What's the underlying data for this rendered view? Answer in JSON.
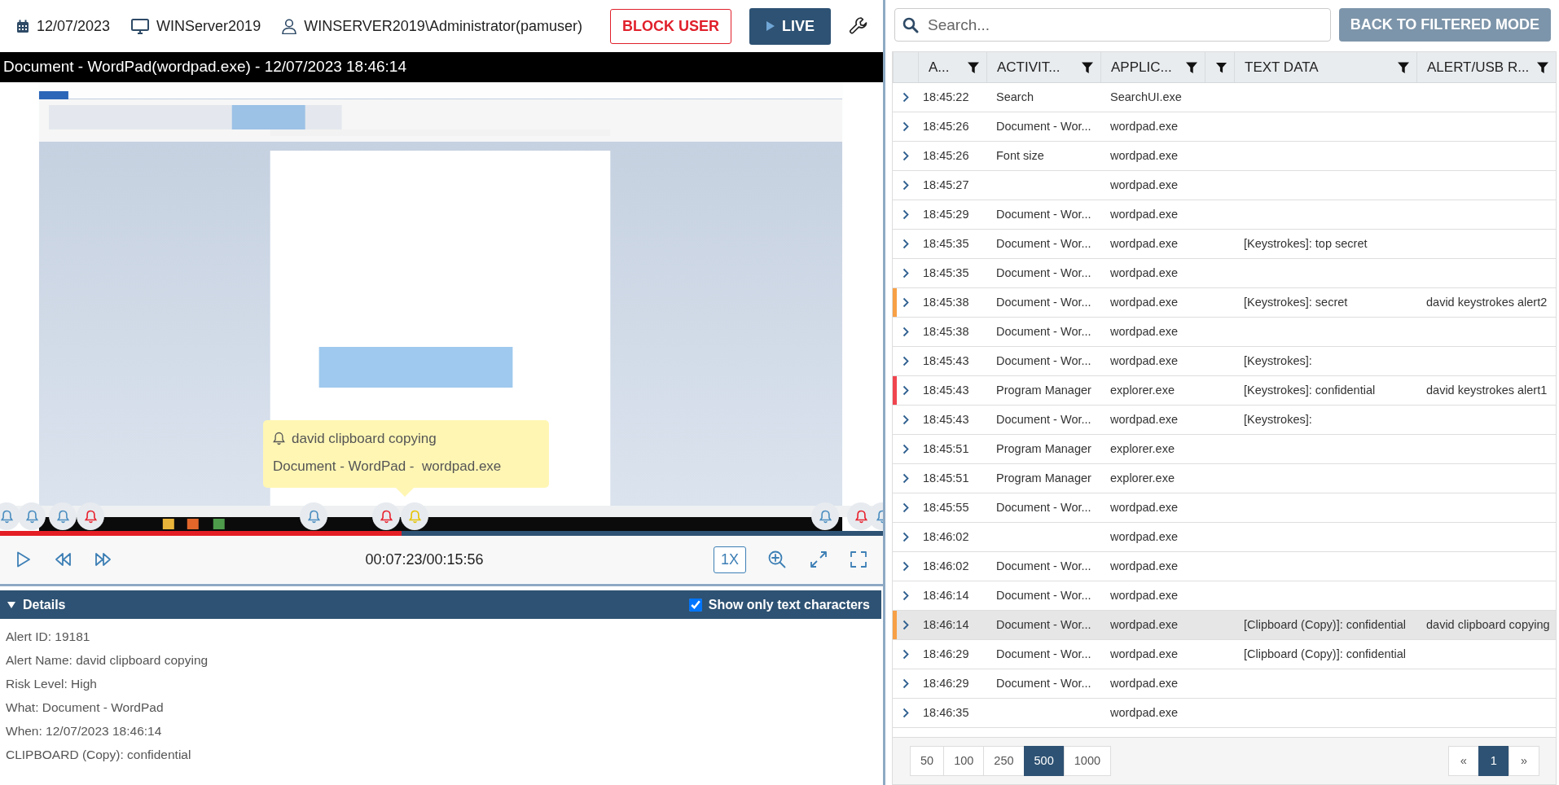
{
  "top_bar": {
    "date": "12/07/2023",
    "host": "WINServer2019",
    "user": "WINSERVER2019\\Administrator(pamuser)",
    "block_button": "BLOCK USER",
    "live_button": "LIVE"
  },
  "player": {
    "title": "Document - WordPad(wordpad.exe) - 12/07/2023 18:46:14",
    "tooltip": {
      "title": "david clipboard copying",
      "detail": "Document - WordPad -  wordpad.exe"
    },
    "markers": [
      {
        "color": "#4a8dc0"
      },
      {
        "color": "#4a8dc0"
      },
      {
        "color": "#4a8dc0"
      },
      {
        "color": "#e8212e"
      },
      {
        "color": "#4a8dc0"
      },
      {
        "color": "#e8212e"
      },
      {
        "color": "#e6c300"
      },
      {
        "color": "#4a8dc0"
      },
      {
        "color": "#e8212e"
      },
      {
        "color": "#4a8dc0"
      }
    ],
    "progress": {
      "level": 0.455
    },
    "time": "00:07:23/00:15:56",
    "speed": "1X"
  },
  "details": {
    "title": "Details",
    "expanded": true,
    "show_only_text": {
      "label": "Show only text characters",
      "checked": true
    },
    "lines": [
      "Alert ID: 19181",
      "Alert Name: david clipboard copying",
      "Risk Level: High",
      "What: Document - WordPad",
      "When: 12/07/2023 18:46:14",
      "CLIPBOARD (Copy): confidential"
    ]
  },
  "search": {
    "placeholder": "Search...",
    "button": "BACK TO FILTERED MODE"
  },
  "table": {
    "columns": [
      {
        "label": "A..."
      },
      {
        "label": "ACTIVIT..."
      },
      {
        "label": "APPLIC..."
      },
      {},
      {
        "label": "TEXT DATA"
      },
      {
        "label": "ALERT/USB R..."
      }
    ],
    "rows": [
      {
        "time": "18:45:22",
        "activity": "Search",
        "application": "SearchUI.exe",
        "selected": false
      },
      {
        "time": "18:45:26",
        "activity": "Document - Wor...",
        "application": "wordpad.exe",
        "selected": false
      },
      {
        "time": "18:45:26",
        "activity": "Font size",
        "application": "wordpad.exe",
        "selected": false
      },
      {
        "time": "18:45:27",
        "application": "wordpad.exe",
        "selected": false
      },
      {
        "time": "18:45:29",
        "activity": "Document - Wor...",
        "application": "wordpad.exe",
        "selected": false
      },
      {
        "time": "18:45:35",
        "activity": "Document - Wor...",
        "application": "wordpad.exe",
        "text_data": "[Keystrokes]: top secret",
        "selected": false
      },
      {
        "time": "18:45:35",
        "activity": "Document - Wor...",
        "application": "wordpad.exe",
        "selected": false
      },
      {
        "time": "18:45:38",
        "activity": "Document - Wor...",
        "application": "wordpad.exe",
        "text_data": "[Keystrokes]: secret",
        "alert": "david keystrokes alert2",
        "color": "#f7a046",
        "selected": false
      },
      {
        "time": "18:45:38",
        "activity": "Document - Wor...",
        "application": "wordpad.exe",
        "selected": false
      },
      {
        "time": "18:45:43",
        "activity": "Document - Wor...",
        "application": "wordpad.exe",
        "text_data": "[Keystrokes]:",
        "selected": false
      },
      {
        "time": "18:45:43",
        "activity": "Program Manager",
        "application": "explorer.exe",
        "text_data": "[Keystrokes]: confidential",
        "alert": "david keystrokes alert1",
        "color": "#f0454f",
        "selected": false
      },
      {
        "time": "18:45:43",
        "activity": "Document - Wor...",
        "application": "wordpad.exe",
        "text_data": "[Keystrokes]:",
        "selected": false
      },
      {
        "time": "18:45:51",
        "activity": "Program Manager",
        "application": "explorer.exe",
        "selected": false
      },
      {
        "time": "18:45:51",
        "activity": "Program Manager",
        "application": "explorer.exe",
        "selected": false
      },
      {
        "time": "18:45:55",
        "activity": "Document - Wor...",
        "application": "wordpad.exe",
        "selected": false
      },
      {
        "time": "18:46:02",
        "application": "wordpad.exe",
        "selected": false
      },
      {
        "time": "18:46:02",
        "activity": "Document - Wor...",
        "application": "wordpad.exe",
        "selected": false
      },
      {
        "time": "18:46:14",
        "activity": "Document - Wor...",
        "application": "wordpad.exe",
        "selected": false
      },
      {
        "time": "18:46:14",
        "activity": "Document - Wor...",
        "application": "wordpad.exe",
        "text_data": "[Clipboard (Copy)]: confidential",
        "alert": "david clipboard copying",
        "color": "#f7a046",
        "selected": true
      },
      {
        "time": "18:46:29",
        "activity": "Document - Wor...",
        "application": "wordpad.exe",
        "text_data": "[Clipboard (Copy)]: confidential",
        "selected": false
      },
      {
        "time": "18:46:29",
        "activity": "Document - Wor...",
        "application": "wordpad.exe",
        "selected": false
      },
      {
        "time": "18:46:35",
        "application": "wordpad.exe",
        "selected": false
      }
    ]
  },
  "page_sizes": [
    {
      "label": "50",
      "selected": false
    },
    {
      "label": "100",
      "selected": false
    },
    {
      "label": "250",
      "selected": false
    },
    {
      "label": "500",
      "selected": true
    },
    {
      "label": "1000",
      "selected": false
    }
  ],
  "pagination": [
    {
      "label": "«",
      "selected": false
    },
    {
      "label": "1",
      "selected": true
    },
    {
      "label": "»",
      "selected": false
    }
  ]
}
